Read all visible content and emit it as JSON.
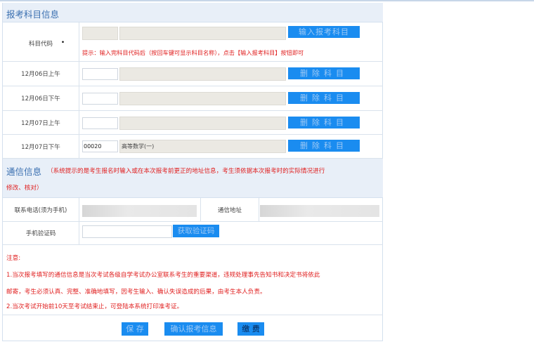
{
  "section1": {
    "title": "报考科目信息"
  },
  "subject_code": {
    "label": "科目代码",
    "required_mark": "•",
    "add_button": "输入报考科目",
    "hint": "提示：输入完科目代码后（按回车键可显示科目名称），点击【输入报考科目】按钮即可"
  },
  "exam_rows": [
    {
      "label": "12月06日上午",
      "code": "",
      "name": "",
      "button": "删除科目"
    },
    {
      "label": "12月06日下午",
      "code": "",
      "name": "",
      "button": "删除科目"
    },
    {
      "label": "12月07日上午",
      "code": "",
      "name": "",
      "button": "删除科目"
    },
    {
      "label": "12月07日下午",
      "code": "00020",
      "name": "高等数学(一)",
      "button": "删除科目"
    }
  ],
  "section2": {
    "title": "通信信息",
    "note_line1": "（系统提示的是考生报名时输入或在本次报考前更正的地址信息，考生须依据本次报考时的实际情况进行",
    "note_line2": "修改、核对）"
  },
  "contact": {
    "phone_label": "联系电话(须为手机)",
    "address_label": "通信地址",
    "verify_label": "手机验证码",
    "verify_button": "获取验证码"
  },
  "notice": {
    "title": "注意:",
    "line1": "1.当次报考填写的通信信息是当次考试各级自学考试办公室联系考生的重要渠道，违规处理事先告知书和决定书将依此",
    "line2": "邮寄，考生必须认真、完整、准确地填写，因考生输入、确认失误造成的后果，由考生本人负责。",
    "line3": "2.当次考试开始前10天至考试结束止，可登陆本系统打印准考证。"
  },
  "actions": {
    "save": "保 存",
    "confirm": "确认报考信息",
    "pay": "缴 费"
  },
  "colors": {
    "accent": "#1a8cf0",
    "header_bg": "#e8eff8",
    "title": "#3a6fb0",
    "warning": "#e02020"
  }
}
